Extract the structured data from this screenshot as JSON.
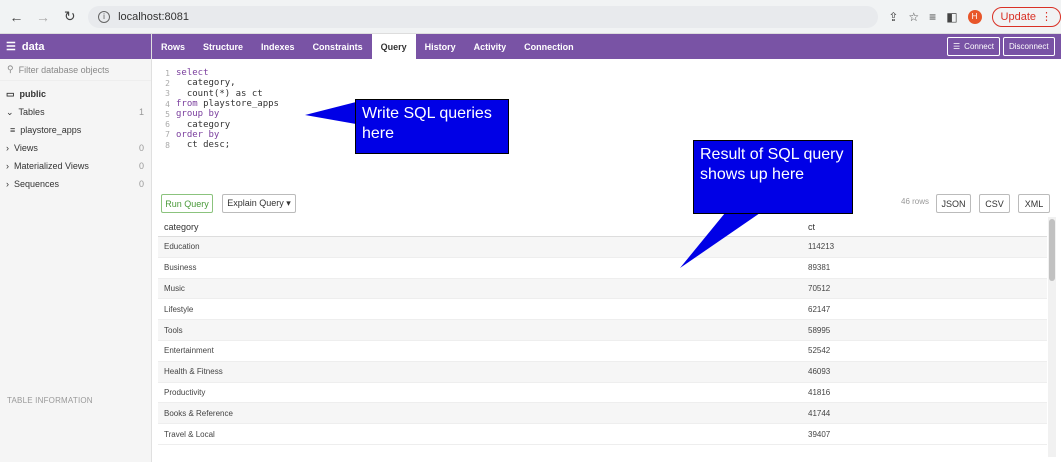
{
  "browser": {
    "url": "localhost:8081",
    "update_label": "Update"
  },
  "sidebar": {
    "db_name": "data",
    "filter_placeholder": "Filter database objects",
    "schema": "public",
    "items": [
      {
        "label": "Tables",
        "count": "1"
      },
      {
        "label": "playstore_apps",
        "count": ""
      },
      {
        "label": "Views",
        "count": "0"
      },
      {
        "label": "Materialized Views",
        "count": "0"
      },
      {
        "label": "Sequences",
        "count": "0"
      }
    ],
    "footer": "TABLE INFORMATION"
  },
  "topnav": {
    "tabs": [
      "Rows",
      "Structure",
      "Indexes",
      "Constraints",
      "Query",
      "History",
      "Activity",
      "Connection"
    ],
    "active_tab": "Query",
    "connect_label": "Connect",
    "disconnect_label": "Disconnect"
  },
  "editor": {
    "lines": [
      {
        "n": "1",
        "kw": "select",
        "code": ""
      },
      {
        "n": "2",
        "kw": "",
        "code": "  category,"
      },
      {
        "n": "3",
        "kw": "",
        "code": "  count(*) as ct"
      },
      {
        "n": "4",
        "kw": "from",
        "code": " playstore_apps"
      },
      {
        "n": "5",
        "kw": "group by",
        "code": ""
      },
      {
        "n": "6",
        "kw": "",
        "code": "  category"
      },
      {
        "n": "7",
        "kw": "order by",
        "code": ""
      },
      {
        "n": "8",
        "kw": "",
        "code": "  ct desc;"
      }
    ]
  },
  "callouts": {
    "write": "Write SQL queries here",
    "result": "Result of SQL query shows up here"
  },
  "toolbar": {
    "run_label": "Run Query",
    "explain_label": "Explain Query ▾",
    "rows_count": "46 rows",
    "json_label": "JSON",
    "csv_label": "CSV",
    "xml_label": "XML"
  },
  "results": {
    "columns": [
      "category",
      "ct"
    ],
    "rows": [
      [
        "Education",
        "114213"
      ],
      [
        "Business",
        "89381"
      ],
      [
        "Music",
        "70512"
      ],
      [
        "Lifestyle",
        "62147"
      ],
      [
        "Tools",
        "58995"
      ],
      [
        "Entertainment",
        "52542"
      ],
      [
        "Health & Fitness",
        "46093"
      ],
      [
        "Productivity",
        "41816"
      ],
      [
        "Books & Reference",
        "41744"
      ],
      [
        "Travel & Local",
        "39407"
      ]
    ]
  },
  "colors": {
    "brand": "#7953a5",
    "callout": "#0000e6",
    "run_green": "#4a9a3a"
  }
}
